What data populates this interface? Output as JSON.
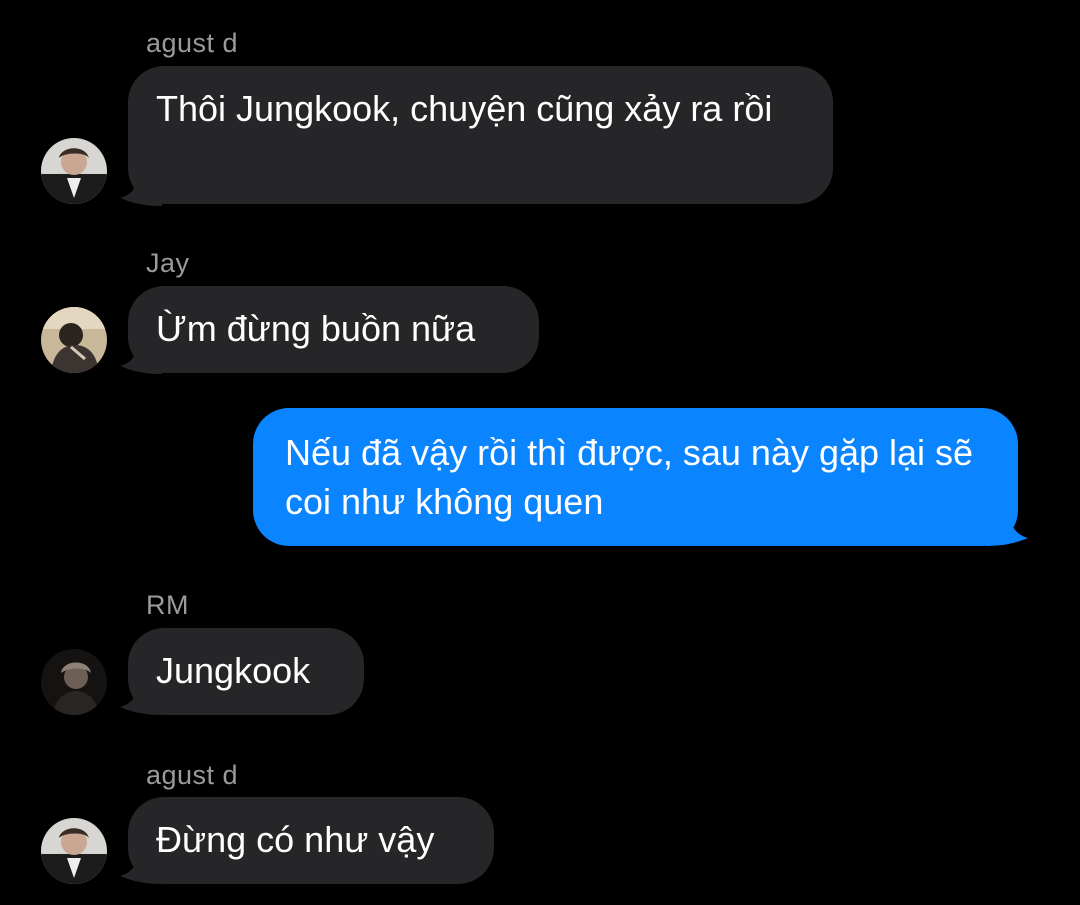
{
  "conversation": {
    "messages": [
      {
        "sender": "agust d",
        "text": "Thôi Jungkook, chuyện cũng xảy ra rồi",
        "direction": "incoming",
        "avatar": "person-avatar"
      },
      {
        "sender": "Jay",
        "text": "Ừm đừng buồn nữa",
        "direction": "incoming",
        "avatar": "person-avatar"
      },
      {
        "sender": "",
        "text": "Nếu đã vậy rồi thì được, sau này gặp lại sẽ coi như không quen",
        "direction": "outgoing"
      },
      {
        "sender": "RM",
        "text": "Jungkook",
        "direction": "incoming",
        "avatar": "person-avatar"
      },
      {
        "sender": "agust d",
        "text": "Đừng có như vậy",
        "direction": "incoming",
        "avatar": "person-avatar"
      }
    ]
  },
  "colors": {
    "background": "#000000",
    "incoming_bubble": "#262629",
    "outgoing_bubble": "#0a84ff",
    "sender_name": "#9a9a9f",
    "message_text": "#ffffff"
  }
}
